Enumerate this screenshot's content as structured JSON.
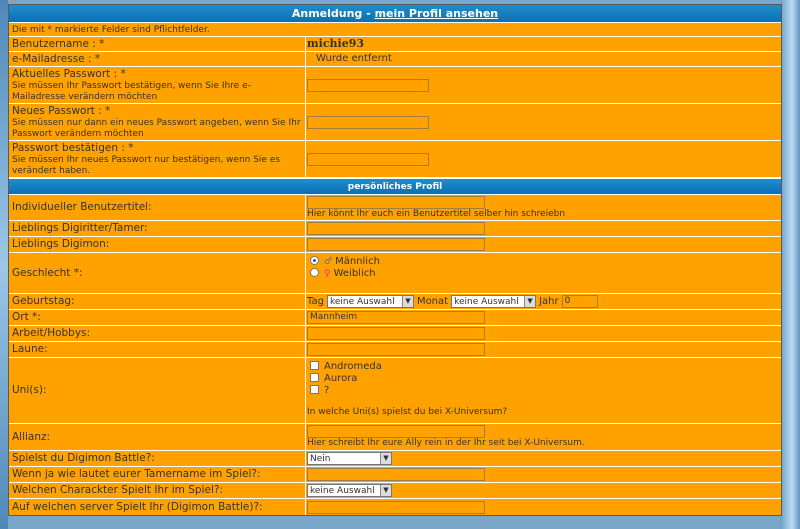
{
  "header": {
    "title": "Anmeldung",
    "separator": "-",
    "link": "mein Profil ansehen"
  },
  "note": "Die mit * markierte Felder sind Pflichtfelder.",
  "account": {
    "username_label": "Benutzername : *",
    "username_value": "michie93",
    "email_label": "e-Mailadresse : *",
    "email_value": "Wurde entfernt",
    "current_pw_label": "Aktuelles Passwort : *",
    "current_pw_hint": "Sie müssen Ihr Passwort bestätigen, wenn Sie Ihre e-Mailadresse verändern möchten",
    "new_pw_label": "Neues Passwort : *",
    "new_pw_hint": "Sie müssen nur dann ein neues Passwort angeben, wenn Sie Ihr Passwort verändern möchten",
    "confirm_pw_label": "Passwort bestätigen : *",
    "confirm_pw_hint": "Sie müssen Ihr neues Passwort nur bestätigen, wenn Sie es verändert haben."
  },
  "profile": {
    "section_title": "persönliches Profil",
    "title_label": "Individueller Benutzertitel:",
    "title_hint": "Hier könnt Ihr euch ein Benutzertitel selber hin schreiebn",
    "tamer_label": "Lieblings Digiritter/Tamer:",
    "digimon_label": "Lieblings Digimon:",
    "gender_label": "Geschlecht *:",
    "gender_male": "Männlich",
    "gender_female": "Weiblich",
    "male_symbol": "♂",
    "female_symbol": "♀",
    "birthday_label": "Geburtstag:",
    "day_label": "Tag",
    "day_value": "keine Auswahl",
    "month_label": "Monat",
    "month_value": "keine Auswahl",
    "year_label": "Jahr",
    "year_value": "0",
    "location_label": "Ort *:",
    "location_value": "Mannheim",
    "hobbies_label": "Arbeit/Hobbys:",
    "mood_label": "Laune:",
    "uni_label": "Uni(s):",
    "uni_options": [
      "Andromeda",
      "Aurora",
      "?"
    ],
    "uni_hint": "In welche Uni(s) spielst du bei X-Universum?",
    "alliance_label": "Allianz:",
    "alliance_hint": "Hier schreibt Ihr eure Ally rein in der Ihr seit bei X-Universum.",
    "battle_label": "Spielst du Digimon Battle?:",
    "battle_value": "Nein",
    "tamer_name_label": "Wenn ja wie lautet eurer Tamername im Spiel?:",
    "character_label": "Welchen Charackter Spielt Ihr im Spiel?:",
    "character_value": "keine Auswahl",
    "server_label": "Auf welchen server Spielt Ihr (Digimon Battle)?:"
  },
  "colors": {
    "header": "#0b6fb0",
    "row": "#ffa200"
  }
}
